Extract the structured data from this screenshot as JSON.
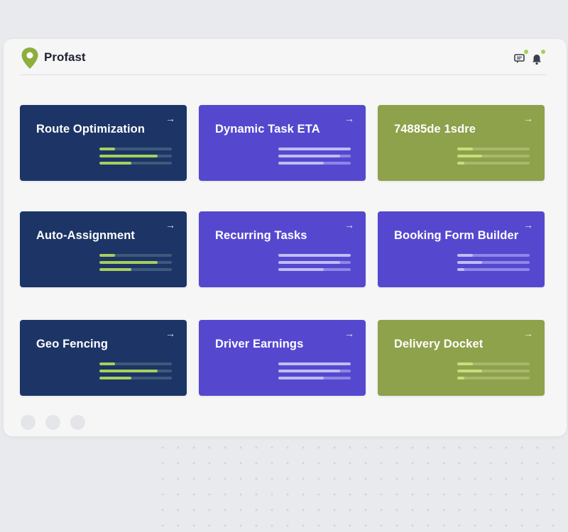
{
  "app": {
    "brand": "Profast",
    "accent": "#8fae3e"
  },
  "header_icons": [
    "chat-icon",
    "bell-icon"
  ],
  "cards": [
    {
      "title": "Route Optimization",
      "theme": "navy",
      "bars": [
        0.22,
        0.8,
        0.44
      ]
    },
    {
      "title": "Dynamic Task ETA",
      "theme": "purple",
      "bars": [
        1.0,
        0.85,
        0.63
      ]
    },
    {
      "title": "74885de 1sdre",
      "theme": "olive",
      "bars": [
        0.22,
        0.34,
        0.1
      ]
    },
    {
      "title": "Auto-Assignment",
      "theme": "navy",
      "bars": [
        0.22,
        0.8,
        0.44
      ]
    },
    {
      "title": "Recurring Tasks",
      "theme": "purple",
      "bars": [
        1.0,
        0.85,
        0.63
      ]
    },
    {
      "title": "Booking Form Builder",
      "theme": "olive-purple",
      "bars": [
        0.22,
        0.34,
        0.1
      ]
    },
    {
      "title": "Geo Fencing",
      "theme": "navy",
      "bars": [
        0.22,
        0.8,
        0.44
      ]
    },
    {
      "title": "Driver Earnings",
      "theme": "purple",
      "bars": [
        1.0,
        0.85,
        0.63
      ]
    },
    {
      "title": "Delivery Docket",
      "theme": "olive",
      "bars": [
        0.22,
        0.34,
        0.1
      ]
    }
  ],
  "pager": {
    "count": 3
  },
  "colors": {
    "navy": "#1c3566",
    "purple": "#5548cf",
    "olive": "#8ea14b",
    "bar_accent": "#a8cf5a"
  }
}
